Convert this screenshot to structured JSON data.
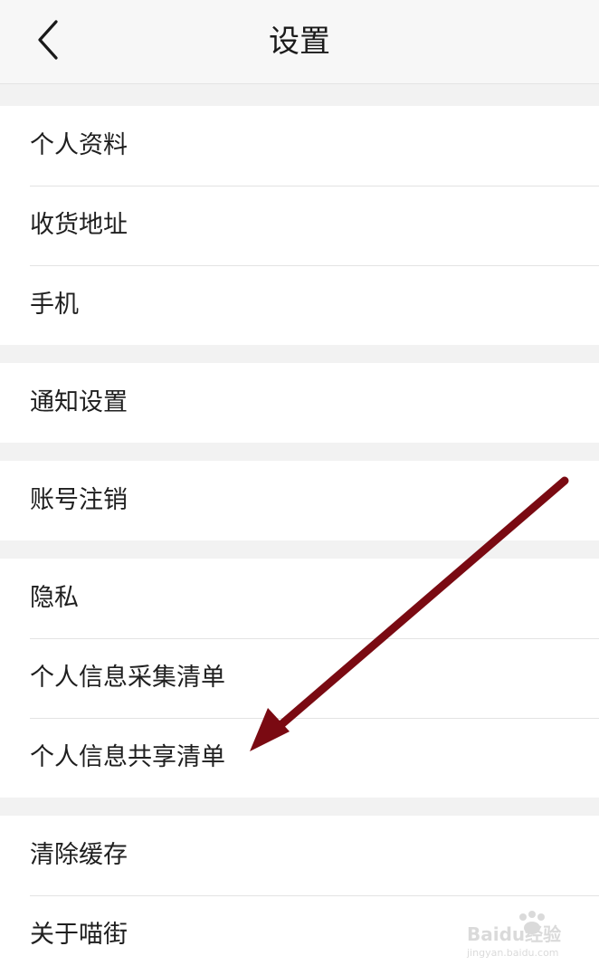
{
  "header": {
    "title": "设置",
    "back_icon": "chevron-left-icon"
  },
  "groups": [
    {
      "items": [
        "个人资料",
        "收货地址",
        "手机"
      ]
    },
    {
      "items": [
        "通知设置"
      ]
    },
    {
      "items": [
        "账号注销"
      ]
    },
    {
      "items": [
        "隐私",
        "个人信息采集清单",
        "个人信息共享清单"
      ]
    },
    {
      "items": [
        "清除缓存",
        "关于喵街"
      ]
    }
  ],
  "annotation": {
    "color": "#7a0a12",
    "target": "个人信息共享清单"
  },
  "watermark": {
    "brand": "Baidu经验",
    "url": "jingyan.baidu.com"
  }
}
